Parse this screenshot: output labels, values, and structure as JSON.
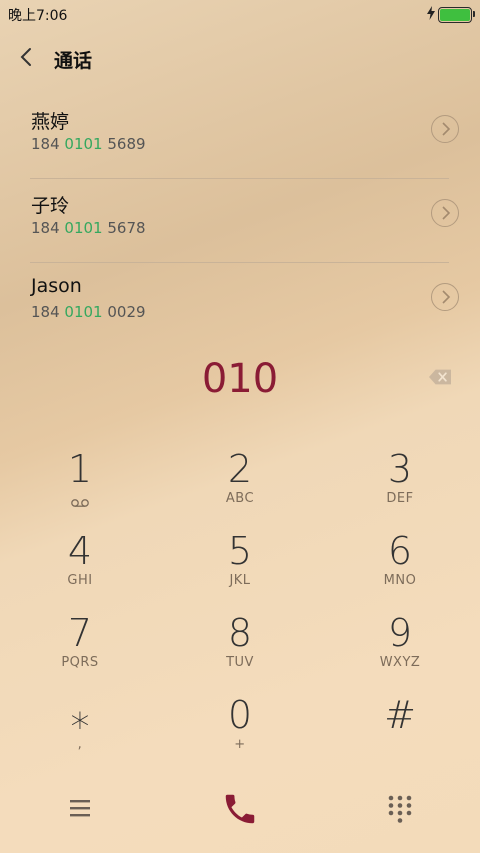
{
  "status_bar": {
    "time": "晚上7:06",
    "battery_color": "#3fbf3f"
  },
  "header": {
    "title": "通话",
    "back_icon": "chevron-left-icon"
  },
  "contacts": [
    {
      "name": "燕婷",
      "number_pre": "184 ",
      "number_match": "0101",
      "number_post": " 5689"
    },
    {
      "name": "子玲",
      "number_pre": "184 ",
      "number_match": "0101",
      "number_post": " 5678"
    },
    {
      "name": "Jason",
      "number_pre": "184 ",
      "number_match": "0101",
      "number_post": " 0029"
    }
  ],
  "dialer": {
    "entered": "010",
    "entered_color": "#8a1c35",
    "match_color": "#35a85f"
  },
  "keypad": [
    {
      "digit": "1",
      "letters": ""
    },
    {
      "digit": "2",
      "letters": "ABC"
    },
    {
      "digit": "3",
      "letters": "DEF"
    },
    {
      "digit": "4",
      "letters": "GHI"
    },
    {
      "digit": "5",
      "letters": "JKL"
    },
    {
      "digit": "6",
      "letters": "MNO"
    },
    {
      "digit": "7",
      "letters": "PQRS"
    },
    {
      "digit": "8",
      "letters": "TUV"
    },
    {
      "digit": "9",
      "letters": "WXYZ"
    },
    {
      "digit": "⁎",
      "letters": ","
    },
    {
      "digit": "0",
      "letters": "+"
    },
    {
      "digit": "#",
      "letters": ""
    }
  ],
  "bottom_bar": {
    "left": "menu-icon",
    "center": "phone-call-icon",
    "right": "dialpad-icon"
  }
}
